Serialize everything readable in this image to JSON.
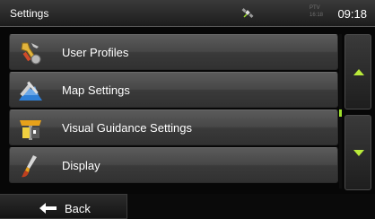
{
  "header": {
    "title": "Settings",
    "gps_icon": "satellite-icon",
    "status_small": "PTV\n16:18",
    "clock": "09:18"
  },
  "menu": {
    "items": [
      {
        "label": "User Profiles",
        "icon": "user-profiles-icon"
      },
      {
        "label": "Map Settings",
        "icon": "map-settings-icon"
      },
      {
        "label": "Visual Guidance Settings",
        "icon": "visual-guidance-icon"
      },
      {
        "label": "Display",
        "icon": "display-brush-icon"
      }
    ]
  },
  "scroll": {
    "up_icon": "arrow-up-icon",
    "down_icon": "arrow-down-icon",
    "accent_color": "#b9ea3a"
  },
  "bottom": {
    "back_label": "Back",
    "back_icon": "arrow-left-icon"
  }
}
